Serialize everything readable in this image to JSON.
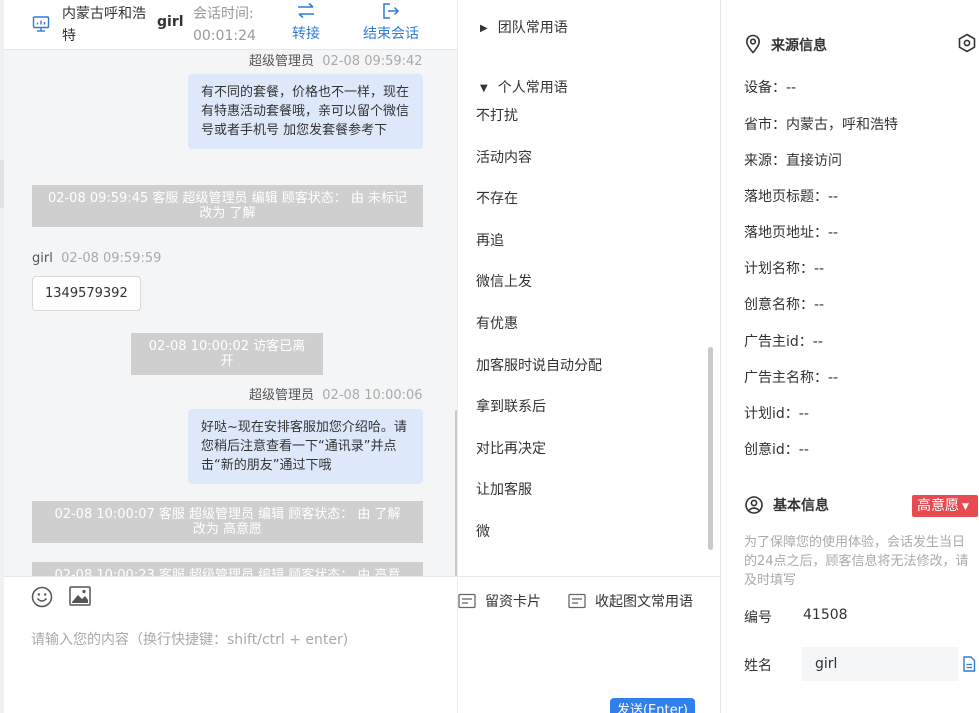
{
  "header": {
    "location": "内蒙古呼和浩特",
    "username": "girl",
    "session_time_label": "会话时间:",
    "session_time": "00:01:24",
    "transfer_label": "转接",
    "end_label": "结束会话"
  },
  "messages": {
    "m1_meta_name": "超级管理员",
    "m1_meta_time": "02-08 09:59:42",
    "m1_text": "有不同的套餐，价格也不一样，现在有特惠活动套餐哦，亲可以留个微信号或者手机号 加您发套餐参考下",
    "sys1": "02-08 09:59:45 客服 超级管理员 编辑 顾客状态： 由 未标记 改为 了解",
    "m2_meta_name": "girl",
    "m2_meta_time": "02-08 09:59:59",
    "m2_text": "1349579392",
    "sys2": "02-08 10:00:02 访客已离开",
    "m3_meta_name": "超级管理员",
    "m3_meta_time": "02-08 10:00:06",
    "m3_text": "好哒~现在安排客服加您介绍哈。请您稍后注意查看一下“通讯录”并点击“新的朋友”通过下哦",
    "sys3": "02-08 10:00:07 客服 超级管理员 编辑 顾客状态： 由 了解 改为 高意愿",
    "sys4": "02-08 10:00:23 客服 超级管理员 编辑 顾客状态： 由 高意"
  },
  "input": {
    "placeholder": "请输入您的内容（换行快捷键：shift/ctrl + enter)"
  },
  "phrases": {
    "team_label": "团队常用语",
    "personal_label": "个人常用语",
    "items": [
      "不打扰",
      "活动内容",
      "不存在",
      "再追",
      "微信上发",
      "有优惠",
      "加客服时说自动分配",
      "拿到联系后",
      "对比再决定",
      "让加客服",
      "微"
    ],
    "card_label": "留资卡片",
    "collapse_label": "收起图文常用语",
    "send_label": "发送(Enter)"
  },
  "source_info": {
    "title": "来源信息",
    "rows": [
      "设备：--",
      "省市：内蒙古，呼和浩特",
      "来源：直接访问",
      "落地页标题：--",
      "落地页地址：--",
      "计划名称：--",
      "创意名称：--",
      "广告主id：--",
      "广告主名称：--",
      "计划id：--",
      "创意id：--"
    ]
  },
  "basic_info": {
    "title": "基本信息",
    "intent": "高意愿",
    "notice": "为了保障您的使用体验，会话发生当日的24点之后，顾客信息将无法修改，请及时填写",
    "id_label": "编号",
    "id_value": "41508",
    "name_label": "姓名",
    "name_value": "girl"
  },
  "colors": {
    "accent": "#2f7bd8",
    "agent_bubble": "#dde9fb",
    "system_bar": "#cfcfcf",
    "intent_badge": "#e84a52",
    "send_button": "#2f80ed"
  }
}
